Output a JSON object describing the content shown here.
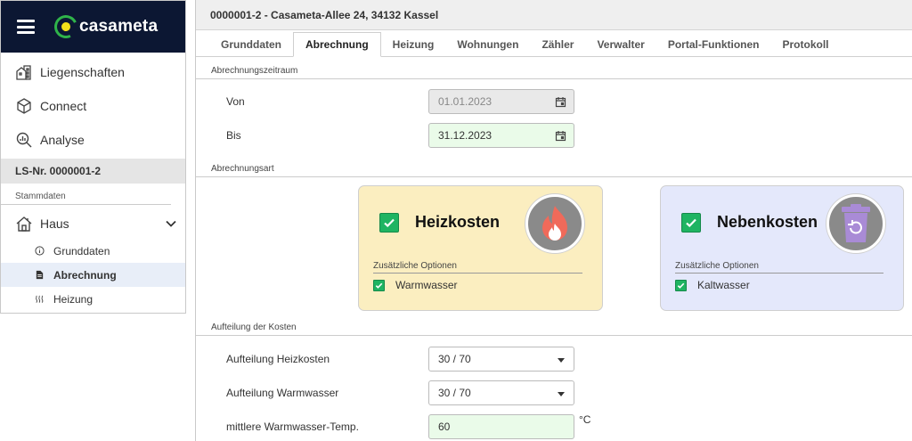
{
  "brand": {
    "logo_text": "casameta"
  },
  "sidebar": {
    "nav": [
      {
        "label": "Liegenschaften",
        "icon": "buildings-icon"
      },
      {
        "label": "Connect",
        "icon": "cube-icon"
      },
      {
        "label": "Analyse",
        "icon": "analysis-icon"
      }
    ],
    "ls_number": "LS-Nr. 0000001-2",
    "section_caption": "Stammdaten",
    "haus_label": "Haus",
    "sub_items": [
      {
        "label": "Grunddaten",
        "icon": "info-icon"
      },
      {
        "label": "Abrechnung",
        "icon": "document-icon",
        "active": true
      },
      {
        "label": "Heizung",
        "icon": "heat-waves-icon"
      }
    ]
  },
  "main": {
    "title": "0000001-2 - Casameta-Allee 24, 34132 Kassel",
    "tabs": [
      "Grunddaten",
      "Abrechnung",
      "Heizung",
      "Wohnungen",
      "Zähler",
      "Verwalter",
      "Portal-Funktionen",
      "Protokoll"
    ],
    "active_tab": "Abrechnung"
  },
  "period": {
    "section": "Abrechnungszeitraum",
    "from_label": "Von",
    "from_value": "01.01.2023",
    "to_label": "Bis",
    "to_value": "31.12.2023"
  },
  "type": {
    "section": "Abrechnungsart",
    "heiz": {
      "title": "Heizkosten",
      "options_caption": "Zusätzliche Optionen",
      "option": "Warmwasser",
      "checked": true
    },
    "neben": {
      "title": "Nebenkosten",
      "options_caption": "Zusätzliche Optionen",
      "option": "Kaltwasser",
      "checked": true
    }
  },
  "split": {
    "section": "Aufteilung der Kosten",
    "heiz_label": "Aufteilung Heizkosten",
    "heiz_value": "30 / 70",
    "ww_label": "Aufteilung Warmwasser",
    "ww_value": "30 / 70",
    "temp_label": "mittlere Warmwasser-Temp.",
    "temp_value": "60",
    "temp_unit": "°C"
  },
  "colors": {
    "brand_dark": "#0c1733",
    "check_green": "#1fb462",
    "heiz_card": "#fbeec0",
    "neben_card": "#e4e8fb",
    "flame": "#f06a5a",
    "bin": "#a98bd6"
  }
}
